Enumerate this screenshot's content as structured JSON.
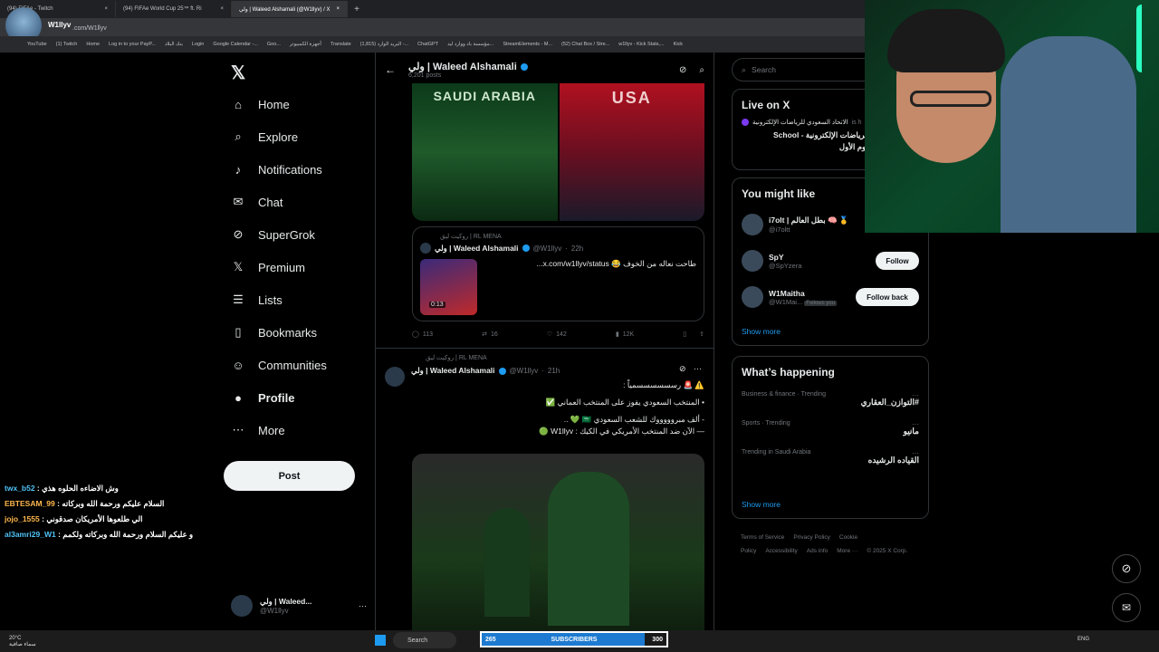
{
  "browser": {
    "tabs": [
      "(94) FIFAe - Twitch",
      "(94) FIFAe World Cup 25™ ft. Ri",
      "ولي | Waleed Alshamali (@W1llyv) / X"
    ],
    "address": ".com/W1llyv",
    "bookmarks": [
      "YouTube",
      "(1) Twitch",
      "Home",
      "Log in to your PayP...",
      "بنك البلاد",
      "Login",
      "Google Calendar -...",
      "Goo...",
      "أجهزة الكمبيوتر",
      "Translate",
      "البريد الوارد (1,815) -...",
      "ChatGPT",
      "مؤسسة باد ووارد ليد...",
      "StreamElements - M...",
      "(52) Chat Box / Stre...",
      "w1llyv - Kick Stats,...",
      "Kick"
    ]
  },
  "streamer": {
    "name": "W1llyv"
  },
  "nav": {
    "items": [
      {
        "label": "Home",
        "icon": "home-icon"
      },
      {
        "label": "Explore",
        "icon": "search-icon"
      },
      {
        "label": "Notifications",
        "icon": "bell-icon"
      },
      {
        "label": "Chat",
        "icon": "mail-icon"
      },
      {
        "label": "SuperGrok",
        "icon": "grok-icon"
      },
      {
        "label": "Premium",
        "icon": "x-icon"
      },
      {
        "label": "Lists",
        "icon": "list-icon"
      },
      {
        "label": "Bookmarks",
        "icon": "bookmark-icon"
      },
      {
        "label": "Communities",
        "icon": "people-icon"
      },
      {
        "label": "Profile",
        "icon": "person-icon"
      },
      {
        "label": "More",
        "icon": "more-icon"
      }
    ],
    "post_label": "Post",
    "account_name": "ولي | Waleed...",
    "account_handle": "@W1llyv"
  },
  "header": {
    "title": "ولي | Waleed Alshamali",
    "posts": "6,201 posts"
  },
  "tweet1": {
    "image_left_text": "SAUDI ARABIA",
    "image_right_text": "USA",
    "quote_community": "روكيت ليق | RL MENA",
    "quote_name": "ولي | Waleed Alshamali",
    "quote_handle": "@W1llyv",
    "quote_time": "22h",
    "quote_text": "طاحت نعاله من الخوف 😂 x.com/w1llyv/status...",
    "video_duration": "0:13",
    "replies": "113",
    "reposts": "16",
    "likes": "142",
    "views": "12K"
  },
  "tweet2": {
    "community": "روكيت ليق | RL MENA",
    "name": "ولي | Waleed Alshamali",
    "handle": "@W1llyv",
    "time": "21h",
    "lines": [
      "⚠️ 🚨 رسسسسسسمياً :",
      "• المنتخب السعودي يفوز على المنتخب العماني ✅",
      "- ألف مبروووووك للشعب السعودي 🇸🇦 💚 ..",
      "— الآن ضد المنتخب الأمريكي في الكيك : W1llyv 🟢"
    ]
  },
  "right": {
    "search_placeholder": "Search",
    "live_title": "Live on X",
    "live_host": "الاتحاد السعودي للرياضات الإلكترونية",
    "live_suffix": "is h",
    "live_text": "دوري المدارس للرياضات الإلكترونية - School eLeague ... | اليوم الأول",
    "might_like_title": "You might like",
    "users": [
      {
        "name": "i7olt | بطل العالم 🧠 🥇",
        "handle": "@i7oltt",
        "button": ""
      },
      {
        "name": "SpY",
        "handle": "@SpYzera",
        "button": "Follow"
      },
      {
        "name": "W1Maitha",
        "handle": "@W1Mai...",
        "badge": "Follows you",
        "button": "Follow back"
      }
    ],
    "show_more": "Show more",
    "happening_title": "What’s happening",
    "trends": [
      {
        "context": "Business & finance · Trending",
        "name": "#التوازن_العقاري"
      },
      {
        "context": "Sports · Trending",
        "name": "مانيو"
      },
      {
        "context": "Trending in Saudi Arabia",
        "name": "القياده الرشيده"
      }
    ],
    "footer": [
      "Terms of Service",
      "Privacy Policy",
      "Cookie Policy",
      "Accessibility",
      "Ads info",
      "More ···",
      "© 2025 X Corp."
    ]
  },
  "chat": [
    {
      "user": "twx_b52",
      "color": "#4fc3f7",
      "msg": "وش الاضاءه الحلوه هذي"
    },
    {
      "user": "EBTESAM_99",
      "color": "#ffb74d",
      "msg": "السلام عليكم ورحمة الله وبركاته"
    },
    {
      "user": "jojo_1555",
      "color": "#ffb74d",
      "msg": "الي طلعوها الأمريكان صدقوني"
    },
    {
      "user": "al3amri29_W1",
      "color": "#4fc3f7",
      "msg": "و عليكم السلام ورحمة الله وبركاته ولكمم"
    }
  ],
  "taskbar": {
    "temp": "20°C",
    "weather": "سماء صافية",
    "search": "Search",
    "sub_count": "265",
    "sub_label": "SUBSCRIBERS",
    "sub_goal": "300",
    "sub_progress": 0.883,
    "lang": "ENG"
  }
}
